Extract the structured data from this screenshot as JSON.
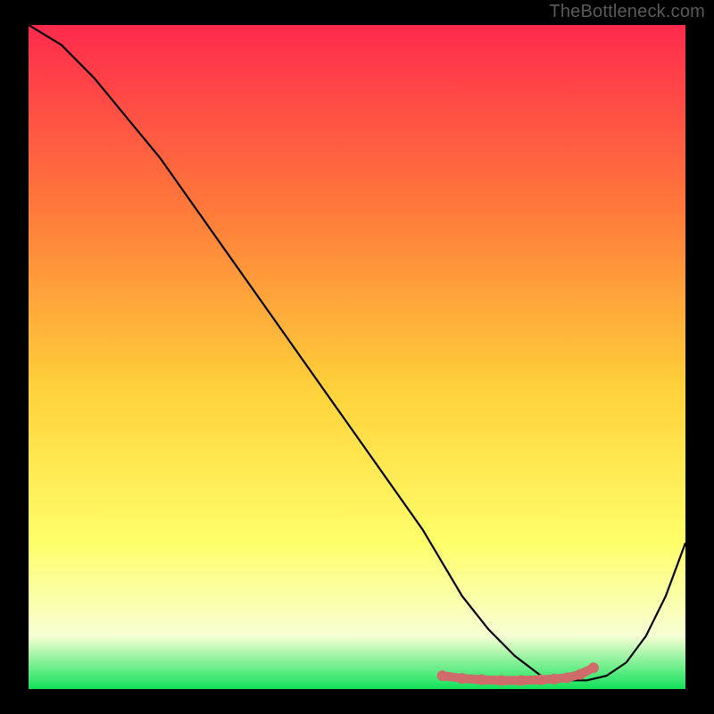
{
  "watermark": "TheBottleneck.com",
  "chart_data": {
    "type": "line",
    "title": "",
    "xlabel": "",
    "ylabel": "",
    "xlim": [
      0,
      100
    ],
    "ylim": [
      0,
      100
    ],
    "grid": false,
    "gradient_colors": {
      "top": "#ff2a4d",
      "mid_high": "#ff7a3a",
      "mid": "#ffd23a",
      "mid_low": "#ffff6a",
      "low": "#f7ffd4",
      "bottom": "#11e25a"
    },
    "series": [
      {
        "name": "bottleneck-curve",
        "color": "#000000",
        "x": [
          0,
          5,
          10,
          15,
          20,
          25,
          30,
          35,
          40,
          45,
          50,
          55,
          60,
          63,
          66,
          70,
          74,
          78,
          80,
          82,
          85,
          88,
          91,
          94,
          97,
          100
        ],
        "y": [
          100,
          97,
          92,
          86,
          80,
          73,
          66,
          59,
          52,
          45,
          38,
          31,
          24,
          19,
          14,
          9,
          5,
          2,
          1.5,
          1.3,
          1.3,
          2,
          4,
          8,
          14,
          22
        ]
      }
    ],
    "highlight": {
      "name": "optimal-range",
      "color": "#cf6b6b",
      "x": [
        63,
        66,
        69,
        72,
        75,
        78,
        80,
        82,
        84,
        86
      ],
      "y": [
        2.0,
        1.6,
        1.4,
        1.3,
        1.3,
        1.4,
        1.5,
        1.7,
        2.2,
        3.2
      ]
    }
  }
}
